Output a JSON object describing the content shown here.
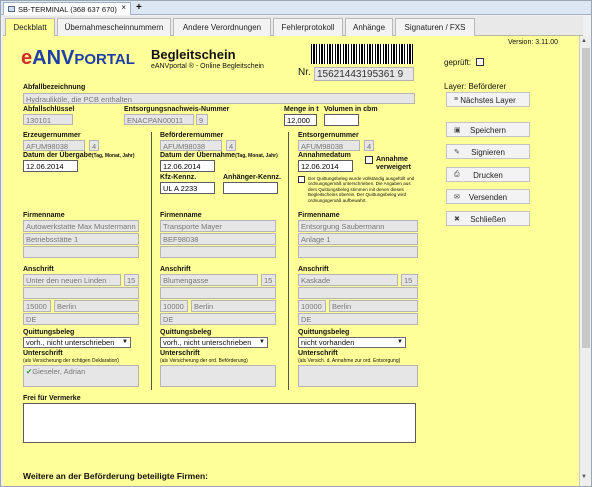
{
  "window": {
    "title": "SB-TERMINAL (368 637 670)",
    "close": "×",
    "add": "+"
  },
  "tabs": [
    "Deckblatt",
    "Übernahmescheinnummern",
    "Andere Verordnungen",
    "Fehlerprotokoll",
    "Anhänge",
    "Signaturen / FXS"
  ],
  "header": {
    "logo_e": "e",
    "logo_anv": "ANV",
    "logo_portal": "PORTAL",
    "title": "Begleitschein",
    "subtitle": "eANVportal ® - Online Begleitschein",
    "nr_label": "Nr.",
    "nr_value": "15621443195361 9",
    "version": "Version: 3.11.00",
    "geprueft": "geprüft:"
  },
  "layer": {
    "label": "Layer: Beförderer",
    "next": "Nächstes Layer"
  },
  "actions": {
    "save": "Speichern",
    "sign": "Signieren",
    "print": "Drucken",
    "send": "Versenden",
    "close": "Schließen"
  },
  "abfall": {
    "bez_label": "Abfallbezeichnung",
    "bez_value": "Hydrauliköle, die PCB enthalten",
    "key_label": "Abfallschlüssel",
    "key_value": "130101",
    "nachweis_label": "Entsorgungsnachweis-Nummer",
    "nachweis_value": "ENACPAN00011",
    "nachweis_nr": "9",
    "menge_label": "Menge in t",
    "menge_value": "12,000",
    "volumen_label": "Volumen in cbm",
    "volumen_value": ""
  },
  "erzeuger": {
    "nr_label": "Erzeugernummer",
    "nr": "AFUM98038",
    "nr2": "4",
    "datum_label": "Datum der Übergabe",
    "datum_hint": "(Tag, Monat, Jahr)",
    "datum": "12.06.2014",
    "firma_label": "Firmenname",
    "firma1": "Autowerkstatte Max Mustermann",
    "firma2": "Betriebsstätte 1",
    "anschrift_label": "Anschrift",
    "strasse": "Unter den neuen Linden",
    "hausnr": "15",
    "plz": "15000",
    "ort": "Berlin",
    "land": "DE",
    "beleg_label": "Quittungsbeleg",
    "beleg": "vorh., nicht unterschrieben",
    "unterschrift_label": "Unterschrift",
    "unterschrift_hint": "(als Versicherung der richtigen Deklaration)",
    "unterschrift": "Gieseler, Adrian"
  },
  "befoerderer": {
    "nr_label": "Beförderernummer",
    "nr": "AFUM98038",
    "nr2": "4",
    "datum_label": "Datum der Übernahme",
    "datum_hint": "(Tag, Monat, Jahr)",
    "datum": "12.06.2014",
    "kfz_label": "Kfz-Kennz.",
    "kfz": "UL A 2233",
    "anh_label": "Anhänger-Kennz.",
    "anh": "",
    "firma_label": "Firmenname",
    "firma1": "Transporte Mayer",
    "firma2": "BEF98038",
    "anschrift_label": "Anschrift",
    "strasse": "Blumengasse",
    "hausnr": "15",
    "plz": "10000",
    "ort": "Berlin",
    "land": "DE",
    "beleg_label": "Quittungsbeleg",
    "beleg": "vorh., nicht unterschrieben",
    "unterschrift_label": "Unterschrift",
    "unterschrift_hint": "(als Versicherung der ord. Beförderung)",
    "unterschrift": ""
  },
  "entsorger": {
    "nr_label": "Entsorgernummer",
    "nr": "AFUM98038",
    "nr2": "4",
    "datum_label": "Annahmedatum",
    "datum": "12.06.2014",
    "annahme_label": "Annahme verweigert",
    "hinweis": "Der Quittungsbeleg wurde vollständig ausgefüllt und ordnungsgemäß unterschrieben. Die Angaben aus dem Quittungsbeleg stimmen mit denen dieses Begleitscheins überein. Der Quittungsbeleg wird ordnungsgemäß aufbewahrt.",
    "firma_label": "Firmenname",
    "firma1": "Entsorgung Saubermann",
    "firma2": "Anlage 1",
    "anschrift_label": "Anschrift",
    "strasse": "Kaskade",
    "hausnr": "15",
    "plz": "10000",
    "ort": "Berlin",
    "land": "DE",
    "beleg_label": "Quittungsbeleg",
    "beleg": "nicht vorhanden",
    "unterschrift_label": "Unterschrift",
    "unterschrift_hint": "(als Versich. d. Annahme zur ord. Entsorgung)",
    "unterschrift": ""
  },
  "vermerke": {
    "label": "Frei für Vermerke",
    "value": ""
  },
  "weitere": "Weitere an der Beförderung beteiligte Firmen:",
  "colors": {
    "form_bg": "#ffff99",
    "logo_blue": "#1f3fa8",
    "logo_red": "#d22d2d"
  }
}
